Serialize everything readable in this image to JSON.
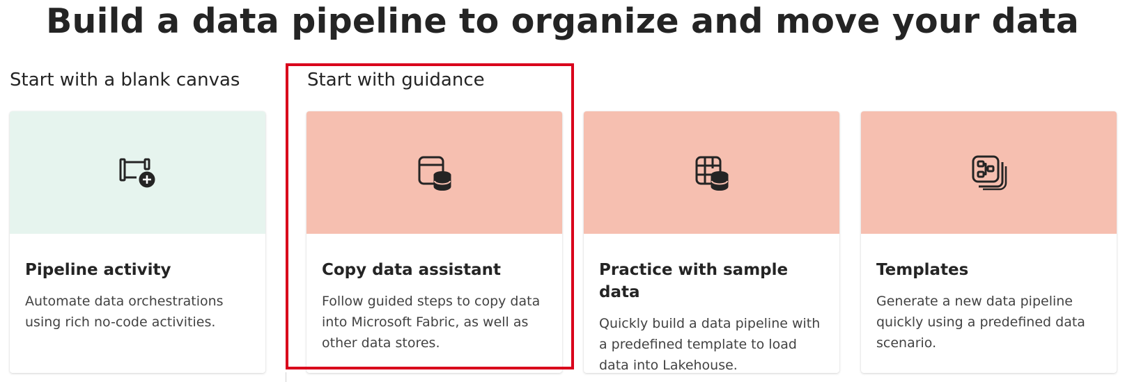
{
  "page": {
    "title": "Build a data pipeline to organize and move your data"
  },
  "sections": {
    "blank": {
      "title": "Start with a blank canvas"
    },
    "guidance": {
      "title": "Start with guidance"
    }
  },
  "colors": {
    "blank_card_bg": "#e6f4ee",
    "guidance_card_bg": "#f6bfb0",
    "highlight": "#d9001b"
  },
  "cards": [
    {
      "title": "Pipeline activity",
      "description": "Automate data orchestrations using rich no-code activities.",
      "icon": "pipeline-add-icon"
    },
    {
      "title": "Copy data assistant",
      "description": "Follow guided steps to copy data into Microsoft Fabric, as well as other data stores.",
      "icon": "copy-data-icon"
    },
    {
      "title": "Practice with sample data",
      "description": "Quickly build a data pipeline with a predefined template to load data into Lakehouse.",
      "icon": "sample-data-icon"
    },
    {
      "title": "Templates",
      "description": "Generate a new data pipeline quickly using a predefined data scenario.",
      "icon": "templates-icon"
    }
  ]
}
